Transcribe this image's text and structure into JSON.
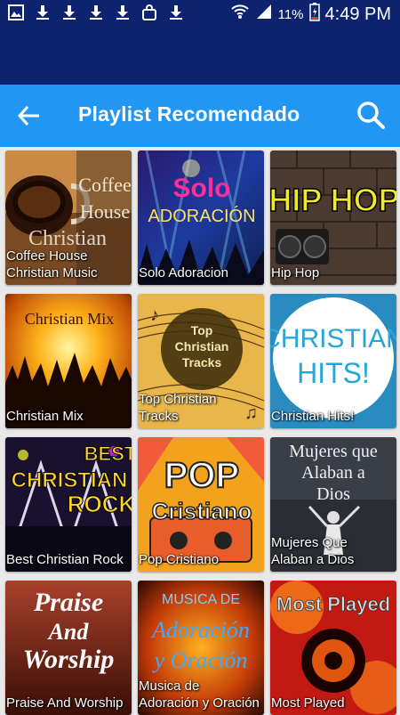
{
  "status_bar": {
    "battery_percent": "11%",
    "time": "4:49 PM",
    "left_icons": [
      "image-icon",
      "download-icon",
      "download-icon",
      "download-icon",
      "download-icon",
      "bag-icon",
      "download-icon"
    ],
    "right_icons": [
      "wifi-icon",
      "signal-icon",
      "battery-icon"
    ]
  },
  "app_bar": {
    "title": "Playlist Recomendado",
    "back_icon": "arrow-left-icon",
    "search_icon": "search-icon"
  },
  "colors": {
    "status_bar": "#0e2370",
    "app_bar": "#2196f3",
    "background": "#e9e9e9"
  },
  "playlists": [
    {
      "label": "Coffee House\nChristian Music",
      "art_text": "Coffee House Christian Music"
    },
    {
      "label": "Solo Adoracion",
      "art_text": "Solo ADORACIÓN"
    },
    {
      "label": "Hip Hop",
      "art_text": "HIP HOP"
    },
    {
      "label": "Christian Mix",
      "art_text": "Christian Mix"
    },
    {
      "label": "Top Christian\nTracks",
      "art_text": "Top Christian Tracks"
    },
    {
      "label": "Christian Hits!",
      "art_text": "CHRISTIAN HITS!"
    },
    {
      "label": "Best Christian Rock",
      "art_text": "BEST CHRISTIAN ROCK"
    },
    {
      "label": "Pop Cristiano",
      "art_text": "POP Cristiano"
    },
    {
      "label": "Mujeres Que\nAlaban a Dios",
      "art_text": "Mujeres que Alaban a Dios"
    },
    {
      "label": "Praise And Worship",
      "art_text": "Praise And Worship"
    },
    {
      "label": "Musica de\nAdoración y Oración",
      "art_text": "MUSICA DE Adoración y Oración"
    },
    {
      "label": "Most Played",
      "art_text": "Most Played"
    }
  ]
}
